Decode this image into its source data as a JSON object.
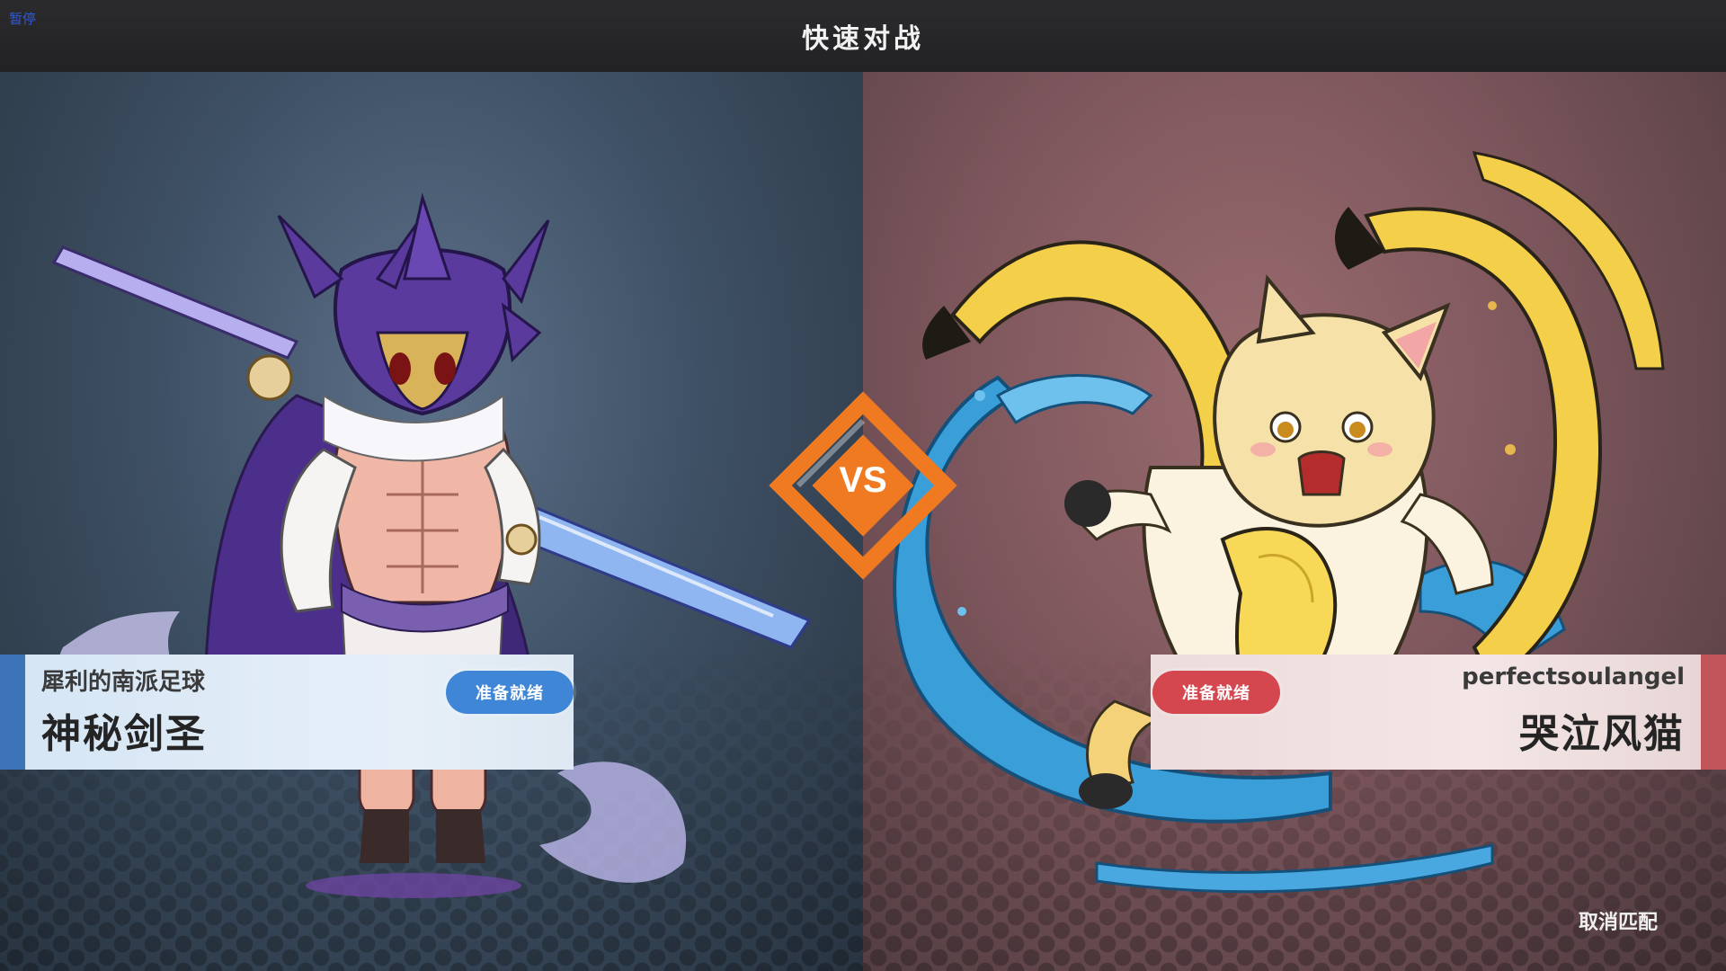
{
  "header": {
    "title": "快速对战",
    "pause_label": "暂停"
  },
  "vs": {
    "text": "VS",
    "accent_color": "#f07a22"
  },
  "player_left": {
    "subname": "犀利的南派足球",
    "character_name": "神秘剑圣",
    "ready_label": "准备就绪",
    "accent_color": "#3d73b8"
  },
  "player_right": {
    "subname": "perfectsoulangel",
    "character_name": "哭泣风猫",
    "ready_label": "准备就绪",
    "accent_color": "#c2555c"
  },
  "footer": {
    "cancel_label": "取消匹配"
  }
}
